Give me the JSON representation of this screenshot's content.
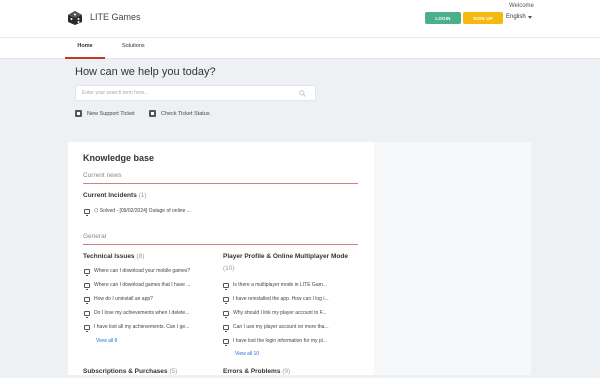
{
  "header": {
    "brand": "LITE Games",
    "welcome": "Welcome",
    "login_label": "LOGIN",
    "signup_label": "SIGN UP",
    "language": "English"
  },
  "nav": {
    "home": "Home",
    "solutions": "Solutions"
  },
  "hero": {
    "title": "How can we help you today?",
    "search_placeholder": "Enter your search term here...",
    "new_ticket": "New Support Ticket",
    "check_status": "Check Ticket Status"
  },
  "kb": {
    "title": "Knowledge base",
    "current_news_label": "Current news",
    "incidents": {
      "title": "Current Incidents",
      "count": "(1)",
      "items": [
        "⬡ Solved - [09/02/2024] Outage of online ..."
      ]
    },
    "general_label": "General",
    "technical": {
      "title": "Technical Issues",
      "count": "(8)",
      "items": [
        "Where can I download your mobile games?",
        "Where can I download games that I have ...",
        "How do I uninstall an app?",
        "Do I lose my achievements when I delete...",
        "I have lost all my achievements. Can I ge..."
      ],
      "view_all": "View all 8"
    },
    "profile": {
      "title": "Player Profile & Online Multiplayer Mode",
      "count": "(10)",
      "items": [
        "Is there a multiplayer mode in LITE Gam...",
        "I have reinstalled the app. How can I log i...",
        "Why should I link my player account to F...",
        "Can I use my player account on more tha...",
        "I have lost the login information for my pl..."
      ],
      "view_all": "View all 10"
    },
    "subscriptions": {
      "title": "Subscriptions & Purchases",
      "count": "(5)"
    },
    "errors": {
      "title": "Errors & Problems",
      "count": "(9)"
    }
  }
}
